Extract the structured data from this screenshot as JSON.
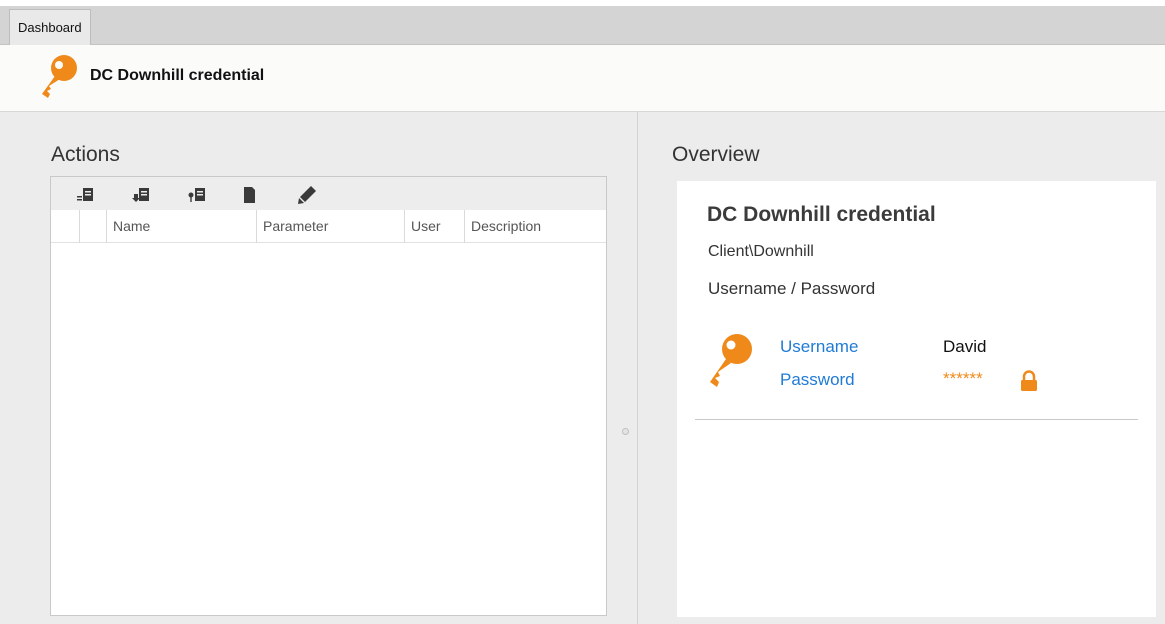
{
  "tabs": [
    {
      "label": "Dashboard"
    }
  ],
  "header": {
    "title": "DC Downhill credential",
    "icon": "key-icon"
  },
  "actions": {
    "title": "Actions",
    "toolbar": [
      "add-action-icon",
      "add-download-icon",
      "add-pin-icon",
      "document-icon",
      "edit-pencil-icon"
    ],
    "columns": [
      "Name",
      "Parameter",
      "User",
      "Description"
    ],
    "rows": []
  },
  "overview": {
    "section_title": "Overview",
    "name": "DC Downhill credential",
    "path": "Client\\Downhill",
    "type": "Username / Password",
    "fields": {
      "username_label": "Username",
      "username_value": "David",
      "password_label": "Password",
      "password_value": "******"
    }
  },
  "colors": {
    "accent_orange": "#ef8a1a",
    "link_blue": "#1f7bd6",
    "panel_bg": "#ececec"
  }
}
